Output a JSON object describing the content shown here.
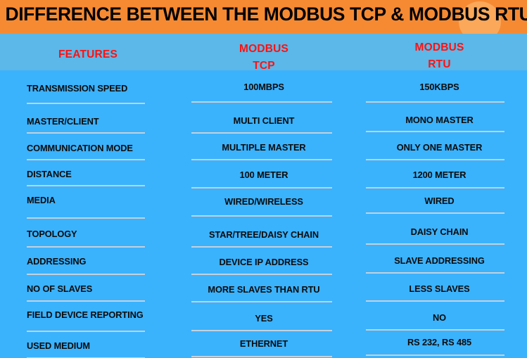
{
  "banner": {
    "title": "DIFFERENCE BETWEEN THE MODBUS TCP & MODBUS RTU",
    "bg_color": "#F68A33",
    "blob_color": "#FBA85A",
    "title_color": "#000000"
  },
  "header": {
    "band_color": "#5BB8E8",
    "text_color": "#FF1111",
    "features_label": "FEATURES",
    "tcp_line1": "MODBUS",
    "tcp_line2": "TCP",
    "rtu_line1": "MODBUS",
    "rtu_line2": "RTU"
  },
  "table": {
    "body_color": "#3BB2FC",
    "divider_color": "#C9D4DC",
    "columns": [
      "FEATURES",
      "MODBUS TCP",
      "MODBUS RTU"
    ],
    "rows": [
      {
        "feature": "TRANSMISSION SPEED",
        "tcp": "100MBPS",
        "rtu": "150KBPS"
      },
      {
        "feature": "MASTER/CLIENT",
        "tcp": "MULTI CLIENT",
        "rtu": "MONO MASTER"
      },
      {
        "feature": "COMMUNICATION MODE",
        "tcp": "MULTIPLE MASTER",
        "rtu": "ONLY ONE MASTER"
      },
      {
        "feature": "DISTANCE",
        "tcp": "100 METER",
        "rtu": "1200 METER"
      },
      {
        "feature": "MEDIA",
        "tcp": "WIRED/WIRELESS",
        "rtu": "WIRED"
      },
      {
        "feature": "TOPOLOGY",
        "tcp": "STAR/TREE/DAISY CHAIN",
        "rtu": "DAISY CHAIN"
      },
      {
        "feature": "ADDRESSING",
        "tcp": "DEVICE IP ADDRESS",
        "rtu": "SLAVE ADDRESSING"
      },
      {
        "feature": "NO OF SLAVES",
        "tcp": "MORE SLAVES THAN RTU",
        "rtu": "LESS SLAVES"
      },
      {
        "feature": "FIELD DEVICE REPORTING",
        "tcp": "YES",
        "rtu": "NO"
      },
      {
        "feature": "USED MEDIUM",
        "tcp": "ETHERNET",
        "rtu": "RS 232, RS 485"
      }
    ]
  },
  "layout": {
    "feature_text_tops": [
      18,
      65,
      103,
      140,
      177,
      225,
      264,
      303,
      340,
      384
    ],
    "feature_div_tops": [
      46,
      88,
      126,
      163,
      209,
      250,
      289,
      327,
      370,
      408
    ],
    "tcp_text_tops": [
      16,
      64,
      102,
      141,
      179,
      226,
      265,
      304,
      345,
      381
    ],
    "tcp_div_tops": [
      44,
      88,
      126,
      166,
      206,
      250,
      289,
      328,
      369,
      406
    ],
    "rtu_text_tops": [
      16,
      63,
      102,
      141,
      178,
      222,
      263,
      303,
      344,
      379
    ],
    "rtu_div_tops": [
      44,
      86,
      126,
      166,
      202,
      246,
      287,
      327,
      368,
      404
    ]
  }
}
